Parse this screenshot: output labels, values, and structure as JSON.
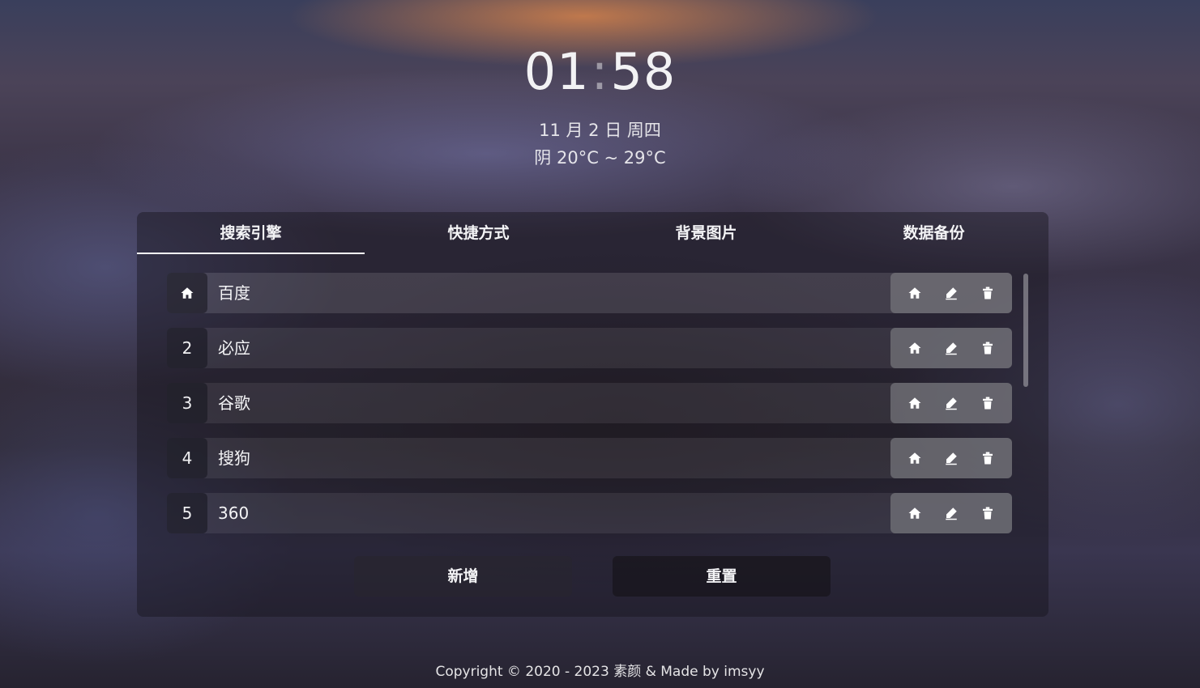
{
  "clock": {
    "hours": "01",
    "separator": ":",
    "minutes": "58"
  },
  "date": "11 月 2 日 周四",
  "weather": "阴 20°C ~ 29°C",
  "tabs": [
    {
      "label": "搜索引擎",
      "active": true
    },
    {
      "label": "快捷方式",
      "active": false
    },
    {
      "label": "背景图片",
      "active": false
    },
    {
      "label": "数据备份",
      "active": false
    }
  ],
  "engines": [
    {
      "index": "",
      "icon": "home-icon",
      "name": "百度",
      "is_default": true
    },
    {
      "index": "2",
      "name": "必应"
    },
    {
      "index": "3",
      "name": "谷歌"
    },
    {
      "index": "4",
      "name": "搜狗"
    },
    {
      "index": "5",
      "name": "360"
    }
  ],
  "row_actions": {
    "set_default_icon": "home-icon",
    "edit_icon": "pencil-icon",
    "delete_icon": "trash-icon"
  },
  "buttons": {
    "add": "新增",
    "reset": "重置"
  },
  "footer": "Copyright © 2020 - 2023 素颜 &  Made by imsyy"
}
